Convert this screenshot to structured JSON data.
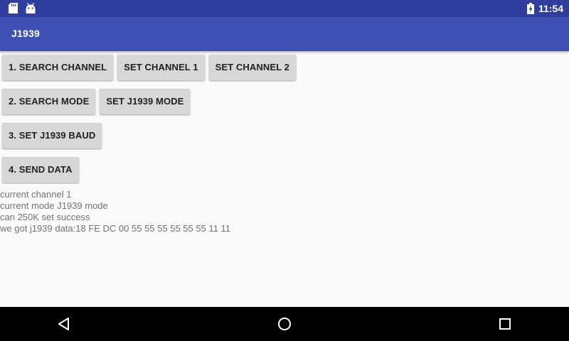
{
  "status_bar": {
    "time": "11:54",
    "icons": [
      "sd-card-icon",
      "android-icon",
      "battery-charging-icon"
    ]
  },
  "app_bar": {
    "title": "J1939"
  },
  "buttons": {
    "search_channel": "1. SEARCH CHANNEL",
    "set_channel_1": "SET CHANNEL 1",
    "set_channel_2": "SET CHANNEL 2",
    "search_mode": "2. SEARCH MODE",
    "set_j1939_mode": "SET J1939 MODE",
    "set_j1939_baud": "3. SET J1939 BAUD",
    "send_data": "4. SEND DATA"
  },
  "log": {
    "lines": [
      "current channel 1",
      "current mode J1939 mode",
      "can 250K set success",
      "we got j1939 data:18 FE DC 00 55 55 55 55 55 55 11 11"
    ]
  },
  "nav_bar": {
    "icons": [
      "back-icon",
      "home-icon",
      "recents-icon"
    ]
  },
  "colors": {
    "status_bar": "#303f9f",
    "app_bar": "#3f51b5",
    "background": "#fafafa",
    "button": "#d6d7d7",
    "log_text": "#737373"
  }
}
